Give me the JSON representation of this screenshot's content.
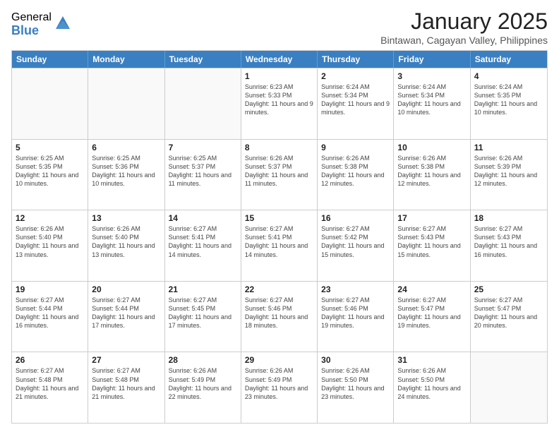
{
  "logo": {
    "general": "General",
    "blue": "Blue"
  },
  "title": "January 2025",
  "subtitle": "Bintawan, Cagayan Valley, Philippines",
  "headers": [
    "Sunday",
    "Monday",
    "Tuesday",
    "Wednesday",
    "Thursday",
    "Friday",
    "Saturday"
  ],
  "rows": [
    [
      {
        "day": "",
        "text": "",
        "empty": true
      },
      {
        "day": "",
        "text": "",
        "empty": true
      },
      {
        "day": "",
        "text": "",
        "empty": true
      },
      {
        "day": "1",
        "text": "Sunrise: 6:23 AM\nSunset: 5:33 PM\nDaylight: 11 hours and 9 minutes.",
        "empty": false
      },
      {
        "day": "2",
        "text": "Sunrise: 6:24 AM\nSunset: 5:34 PM\nDaylight: 11 hours and 9 minutes.",
        "empty": false
      },
      {
        "day": "3",
        "text": "Sunrise: 6:24 AM\nSunset: 5:34 PM\nDaylight: 11 hours and 10 minutes.",
        "empty": false
      },
      {
        "day": "4",
        "text": "Sunrise: 6:24 AM\nSunset: 5:35 PM\nDaylight: 11 hours and 10 minutes.",
        "empty": false
      }
    ],
    [
      {
        "day": "5",
        "text": "Sunrise: 6:25 AM\nSunset: 5:35 PM\nDaylight: 11 hours and 10 minutes.",
        "empty": false
      },
      {
        "day": "6",
        "text": "Sunrise: 6:25 AM\nSunset: 5:36 PM\nDaylight: 11 hours and 10 minutes.",
        "empty": false
      },
      {
        "day": "7",
        "text": "Sunrise: 6:25 AM\nSunset: 5:37 PM\nDaylight: 11 hours and 11 minutes.",
        "empty": false
      },
      {
        "day": "8",
        "text": "Sunrise: 6:26 AM\nSunset: 5:37 PM\nDaylight: 11 hours and 11 minutes.",
        "empty": false
      },
      {
        "day": "9",
        "text": "Sunrise: 6:26 AM\nSunset: 5:38 PM\nDaylight: 11 hours and 12 minutes.",
        "empty": false
      },
      {
        "day": "10",
        "text": "Sunrise: 6:26 AM\nSunset: 5:38 PM\nDaylight: 11 hours and 12 minutes.",
        "empty": false
      },
      {
        "day": "11",
        "text": "Sunrise: 6:26 AM\nSunset: 5:39 PM\nDaylight: 11 hours and 12 minutes.",
        "empty": false
      }
    ],
    [
      {
        "day": "12",
        "text": "Sunrise: 6:26 AM\nSunset: 5:40 PM\nDaylight: 11 hours and 13 minutes.",
        "empty": false
      },
      {
        "day": "13",
        "text": "Sunrise: 6:26 AM\nSunset: 5:40 PM\nDaylight: 11 hours and 13 minutes.",
        "empty": false
      },
      {
        "day": "14",
        "text": "Sunrise: 6:27 AM\nSunset: 5:41 PM\nDaylight: 11 hours and 14 minutes.",
        "empty": false
      },
      {
        "day": "15",
        "text": "Sunrise: 6:27 AM\nSunset: 5:41 PM\nDaylight: 11 hours and 14 minutes.",
        "empty": false
      },
      {
        "day": "16",
        "text": "Sunrise: 6:27 AM\nSunset: 5:42 PM\nDaylight: 11 hours and 15 minutes.",
        "empty": false
      },
      {
        "day": "17",
        "text": "Sunrise: 6:27 AM\nSunset: 5:43 PM\nDaylight: 11 hours and 15 minutes.",
        "empty": false
      },
      {
        "day": "18",
        "text": "Sunrise: 6:27 AM\nSunset: 5:43 PM\nDaylight: 11 hours and 16 minutes.",
        "empty": false
      }
    ],
    [
      {
        "day": "19",
        "text": "Sunrise: 6:27 AM\nSunset: 5:44 PM\nDaylight: 11 hours and 16 minutes.",
        "empty": false
      },
      {
        "day": "20",
        "text": "Sunrise: 6:27 AM\nSunset: 5:44 PM\nDaylight: 11 hours and 17 minutes.",
        "empty": false
      },
      {
        "day": "21",
        "text": "Sunrise: 6:27 AM\nSunset: 5:45 PM\nDaylight: 11 hours and 17 minutes.",
        "empty": false
      },
      {
        "day": "22",
        "text": "Sunrise: 6:27 AM\nSunset: 5:46 PM\nDaylight: 11 hours and 18 minutes.",
        "empty": false
      },
      {
        "day": "23",
        "text": "Sunrise: 6:27 AM\nSunset: 5:46 PM\nDaylight: 11 hours and 19 minutes.",
        "empty": false
      },
      {
        "day": "24",
        "text": "Sunrise: 6:27 AM\nSunset: 5:47 PM\nDaylight: 11 hours and 19 minutes.",
        "empty": false
      },
      {
        "day": "25",
        "text": "Sunrise: 6:27 AM\nSunset: 5:47 PM\nDaylight: 11 hours and 20 minutes.",
        "empty": false
      }
    ],
    [
      {
        "day": "26",
        "text": "Sunrise: 6:27 AM\nSunset: 5:48 PM\nDaylight: 11 hours and 21 minutes.",
        "empty": false
      },
      {
        "day": "27",
        "text": "Sunrise: 6:27 AM\nSunset: 5:48 PM\nDaylight: 11 hours and 21 minutes.",
        "empty": false
      },
      {
        "day": "28",
        "text": "Sunrise: 6:26 AM\nSunset: 5:49 PM\nDaylight: 11 hours and 22 minutes.",
        "empty": false
      },
      {
        "day": "29",
        "text": "Sunrise: 6:26 AM\nSunset: 5:49 PM\nDaylight: 11 hours and 23 minutes.",
        "empty": false
      },
      {
        "day": "30",
        "text": "Sunrise: 6:26 AM\nSunset: 5:50 PM\nDaylight: 11 hours and 23 minutes.",
        "empty": false
      },
      {
        "day": "31",
        "text": "Sunrise: 6:26 AM\nSunset: 5:50 PM\nDaylight: 11 hours and 24 minutes.",
        "empty": false
      },
      {
        "day": "",
        "text": "",
        "empty": true
      }
    ]
  ]
}
